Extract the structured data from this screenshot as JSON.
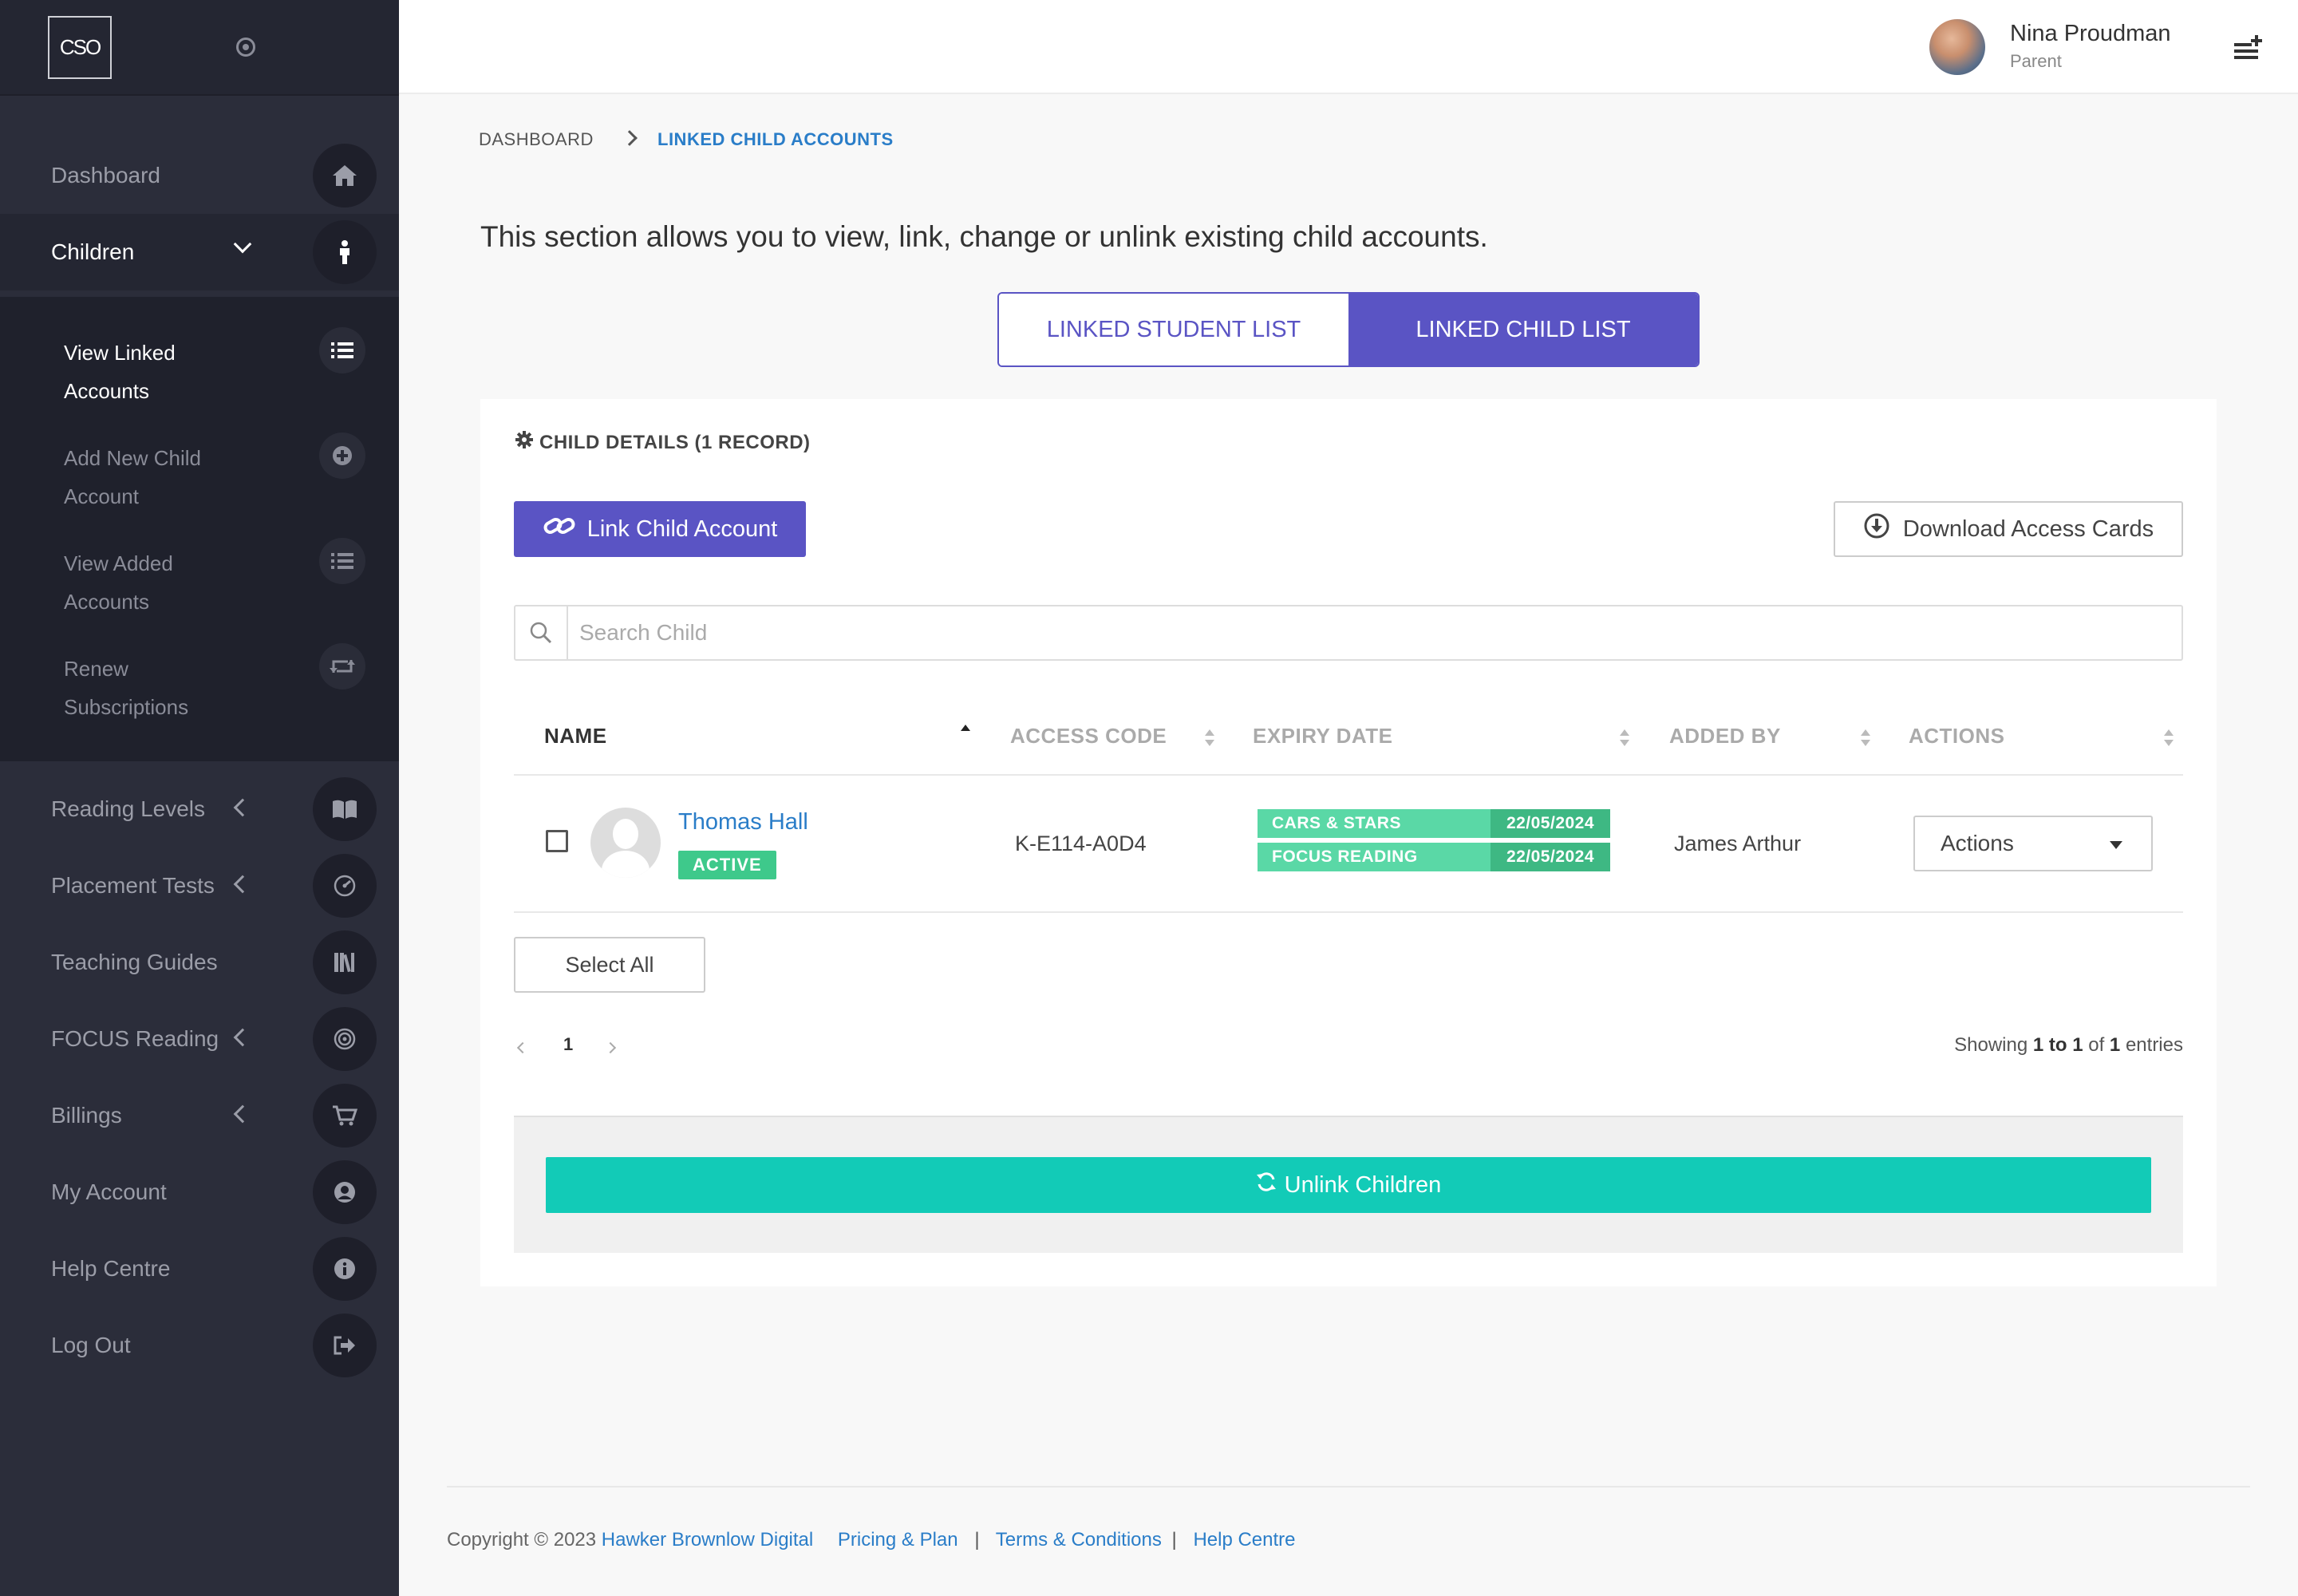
{
  "sidebar": {
    "logo_text": "CSO",
    "nav": [
      {
        "label": "Dashboard",
        "icon": "home-icon"
      },
      {
        "label": "Children",
        "icon": "child-icon"
      },
      {
        "label": "Reading Levels",
        "icon": "book-icon"
      },
      {
        "label": "Placement Tests",
        "icon": "gauge-icon"
      },
      {
        "label": "Teaching Guides",
        "icon": "books-icon"
      },
      {
        "label": "FOCUS Reading",
        "icon": "target-icon"
      },
      {
        "label": "Billings",
        "icon": "cart-icon"
      },
      {
        "label": "My Account",
        "icon": "user-icon"
      },
      {
        "label": "Help Centre",
        "icon": "info-icon"
      },
      {
        "label": "Log Out",
        "icon": "logout-icon"
      }
    ],
    "children_submenu": [
      {
        "line1": "View Linked",
        "line2": "Accounts",
        "icon": "list-icon"
      },
      {
        "line1": "Add New Child",
        "line2": "Account",
        "icon": "plus-circle-icon"
      },
      {
        "line1": "View Added",
        "line2": "Accounts",
        "icon": "list-icon"
      },
      {
        "line1": "Renew",
        "line2": "Subscriptions",
        "icon": "retweet-icon"
      }
    ]
  },
  "header": {
    "user_name": "Nina Proudman",
    "user_role": "Parent"
  },
  "breadcrumb": {
    "home": "DASHBOARD",
    "current": "LINKED CHILD ACCOUNTS"
  },
  "intro_text": "This section allows you to view, link, change or unlink existing child accounts.",
  "tabs": {
    "student": "LINKED STUDENT LIST",
    "child": "LINKED CHILD LIST"
  },
  "panel": {
    "title": "CHILD DETAILS (1 RECORD)",
    "link_button": "Link Child Account",
    "download_button": "Download Access Cards",
    "search_placeholder": "Search Child",
    "columns": {
      "name": "NAME",
      "access_code": "ACCESS CODE",
      "expiry_date": "EXPIRY DATE",
      "added_by": "ADDED BY",
      "actions": "ACTIONS"
    },
    "rows": [
      {
        "name": "Thomas Hall",
        "status": "ACTIVE",
        "access_code": "K-E114-A0D4",
        "subscriptions": [
          {
            "name": "CARS & STARS",
            "date": "22/05/2024"
          },
          {
            "name": "FOCUS READING",
            "date": "22/05/2024"
          }
        ],
        "added_by": "James Arthur",
        "actions_label": "Actions"
      }
    ],
    "select_all": "Select All",
    "pagination": {
      "current_page": "1"
    },
    "showing": {
      "prefix": "Showing",
      "from": "1",
      "to_word": "to",
      "to": "1",
      "of_word": "of",
      "total": "1",
      "suffix": "entries"
    },
    "unlink_button": "Unlink Children"
  },
  "footer": {
    "copyright": "Copyright © 2023",
    "company": "Hawker Brownlow Digital",
    "pricing": "Pricing & Plan",
    "terms": "Terms & Conditions",
    "help": "Help Centre",
    "separator": "|"
  },
  "colors": {
    "sidebar_bg": "#2b2d3a",
    "primary": "#5a54c4",
    "link": "#2a7dc8",
    "teal": "#12cbb7",
    "badge_green": "#3ec98b"
  }
}
